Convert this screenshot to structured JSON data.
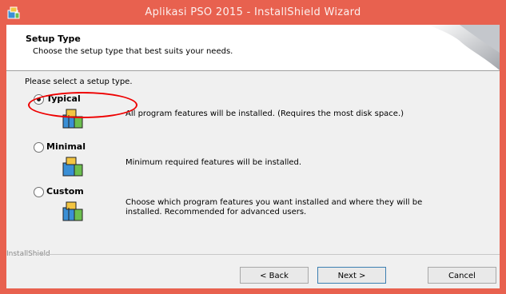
{
  "window": {
    "title": "Aplikasi PSO 2015 - InstallShield Wizard"
  },
  "header": {
    "title": "Setup Type",
    "subtitle": "Choose the setup type that best suits your needs."
  },
  "prompt": "Please select a setup type.",
  "options": [
    {
      "label": "Typical",
      "description": "All program features will be installed. (Requires the most disk space.)",
      "selected": true
    },
    {
      "label": "Minimal",
      "description": "Minimum required features will be installed.",
      "selected": false
    },
    {
      "label": "Custom",
      "description": "Choose which program features you want installed and where they will be installed. Recommended for advanced users.",
      "selected": false
    }
  ],
  "footer": {
    "brand": "InstallShield"
  },
  "buttons": {
    "back": "< Back",
    "next": "Next >",
    "cancel": "Cancel"
  },
  "colors": {
    "titlebar": "#e8614f",
    "highlight_ring": "#e00000"
  }
}
